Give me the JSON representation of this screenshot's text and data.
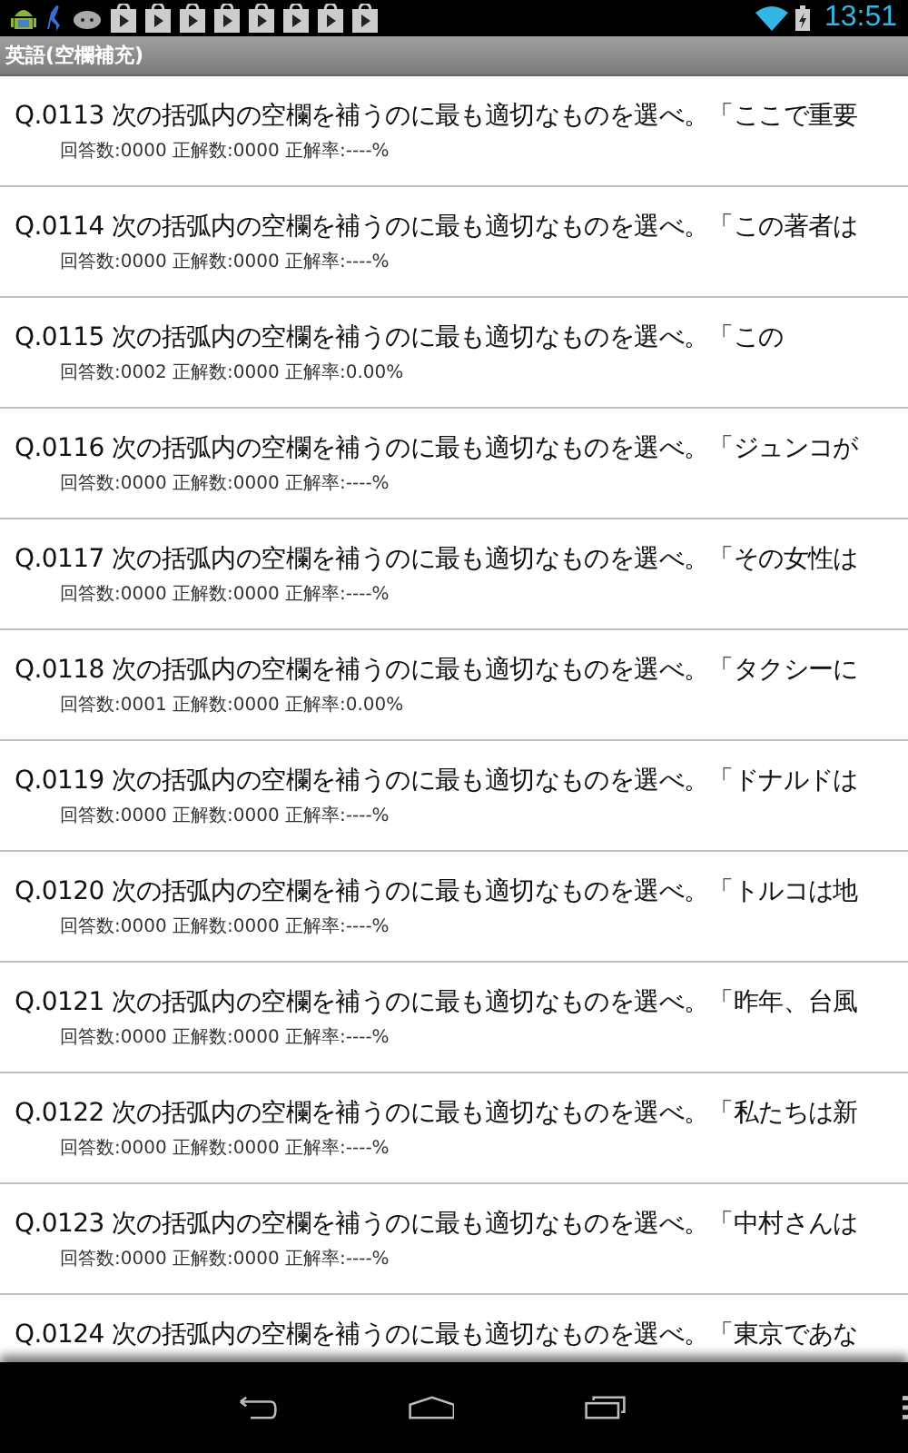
{
  "status_bar": {
    "notifications": [
      {
        "kind": "android"
      },
      {
        "kind": "runner"
      },
      {
        "kind": "cloud"
      },
      {
        "kind": "bag"
      },
      {
        "kind": "bag"
      },
      {
        "kind": "bag"
      },
      {
        "kind": "bag"
      },
      {
        "kind": "bag"
      },
      {
        "kind": "bag"
      },
      {
        "kind": "bag"
      },
      {
        "kind": "bag"
      }
    ],
    "time": "13:51"
  },
  "action_bar": {
    "title": "英語(空欄補充)"
  },
  "questions": [
    {
      "title": "Q.0113 次の括弧内の空欄を補うのに最も適切なものを選べ。「ここで重要",
      "stats": "回答数:0000 正解数:0000 正解率:----%"
    },
    {
      "title": "Q.0114 次の括弧内の空欄を補うのに最も適切なものを選べ。「この著者は",
      "stats": "回答数:0000 正解数:0000 正解率:----%"
    },
    {
      "title": "Q.0115 次の括弧内の空欄を補うのに最も適切なものを選べ。「この",
      "stats": "回答数:0002 正解数:0000 正解率:0.00%"
    },
    {
      "title": "Q.0116 次の括弧内の空欄を補うのに最も適切なものを選べ。「ジュンコが",
      "stats": "回答数:0000 正解数:0000 正解率:----%"
    },
    {
      "title": "Q.0117 次の括弧内の空欄を補うのに最も適切なものを選べ。「その女性は",
      "stats": "回答数:0000 正解数:0000 正解率:----%"
    },
    {
      "title": "Q.0118 次の括弧内の空欄を補うのに最も適切なものを選べ。「タクシーに",
      "stats": "回答数:0001 正解数:0000 正解率:0.00%"
    },
    {
      "title": "Q.0119 次の括弧内の空欄を補うのに最も適切なものを選べ。「ドナルドは",
      "stats": "回答数:0000 正解数:0000 正解率:----%"
    },
    {
      "title": "Q.0120 次の括弧内の空欄を補うのに最も適切なものを選べ。「トルコは地",
      "stats": "回答数:0000 正解数:0000 正解率:----%"
    },
    {
      "title": "Q.0121 次の括弧内の空欄を補うのに最も適切なものを選べ。「昨年、台風",
      "stats": "回答数:0000 正解数:0000 正解率:----%"
    },
    {
      "title": "Q.0122 次の括弧内の空欄を補うのに最も適切なものを選べ。「私たちは新",
      "stats": "回答数:0000 正解数:0000 正解率:----%"
    },
    {
      "title": "Q.0123 次の括弧内の空欄を補うのに最も適切なものを選べ。「中村さんは",
      "stats": "回答数:0000 正解数:0000 正解率:----%"
    },
    {
      "title": "Q.0124 次の括弧内の空欄を補うのに最も適切なものを選べ。「東京であな"
    }
  ]
}
